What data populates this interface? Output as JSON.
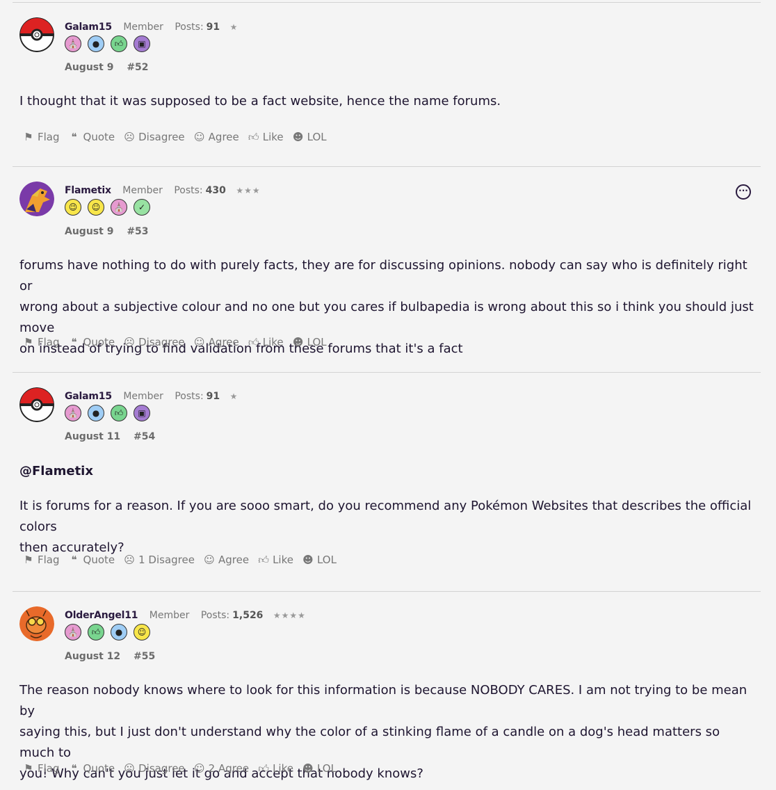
{
  "posts": [
    {
      "username": "Galam15",
      "user_title": "Member",
      "posts_label": "Posts:",
      "posts_count": "91",
      "stars": "★",
      "avatar": "pokeball-avatar",
      "badges": [
        "cake-icon",
        "speech-bubble-icon",
        "thumbs-up-icon",
        "notebook-icon"
      ],
      "date": "August 9",
      "number": "#52",
      "mention": "",
      "text": "I thought that it was supposed to be a fact website, hence the name forums.",
      "text_lines": [
        "I thought that it was supposed to be a fact website, hence the name forums."
      ],
      "actions": {
        "flag": "Flag",
        "quote": "Quote",
        "disagree": "Disagree",
        "agree": "Agree",
        "like": "Like",
        "lol": "LOL"
      }
    },
    {
      "username": "Flametix",
      "user_title": "Member",
      "posts_label": "Posts:",
      "posts_count": "430",
      "stars": "★★★",
      "avatar": "charizard-avatar",
      "badges": [
        "wink-face-icon",
        "smile-face-icon",
        "cake-icon",
        "check-icon"
      ],
      "date": "August 9",
      "number": "#53",
      "mention": "",
      "text_lines": [
        "forums have nothing to do with purely facts, they are for discussing opinions. nobody can say who is definitely right or",
        "wrong about a subjective colour and no one but you cares if bulbapedia is wrong about this so i think you should just move",
        "on instead of trying to find validation from these forums that it's a fact"
      ],
      "actions": {
        "flag": "Flag",
        "quote": "Quote",
        "disagree": "Disagree",
        "agree": "Agree",
        "like": "Like",
        "lol": "LOL"
      }
    },
    {
      "username": "Galam15",
      "user_title": "Member",
      "posts_label": "Posts:",
      "posts_count": "91",
      "stars": "★",
      "avatar": "pokeball-avatar",
      "badges": [
        "cake-icon",
        "speech-bubble-icon",
        "thumbs-up-icon",
        "notebook-icon"
      ],
      "date": "August 11",
      "number": "#54",
      "mention": "@Flametix",
      "text_lines": [
        "It is forums for a reason. If you are sooo smart, do you recommend any Pokémon Websites that describes the official colors",
        "then accurately?"
      ],
      "actions": {
        "flag": "Flag",
        "quote": "Quote",
        "disagree": "1 Disagree",
        "agree": "Agree",
        "like": "Like",
        "lol": "LOL"
      }
    },
    {
      "username": "OlderAngel11",
      "user_title": "Member",
      "posts_label": "Posts:",
      "posts_count": "1,526",
      "stars": "★★★★",
      "avatar": "drawing-avatar",
      "badges": [
        "cake-icon",
        "thumbs-up-icon",
        "speech-bubble-icon",
        "smile-face-icon"
      ],
      "date": "August 12",
      "number": "#55",
      "mention": "",
      "text_lines": [
        "The reason nobody knows where to look for this information is because NOBODY CARES. I am not trying to be mean by",
        "saying this, but I just don't understand why the color of a stinking flame of a candle on a dog's head matters so much to",
        "you! Why can't you just let it go and accept that nobody knows?"
      ],
      "actions": {
        "flag": "Flag",
        "quote": "Quote",
        "disagree": "Disagree",
        "agree": "2 Agree",
        "like": "Like",
        "lol": "LOL"
      }
    }
  ],
  "more_menu_icon": "ellipsis-circle-icon"
}
